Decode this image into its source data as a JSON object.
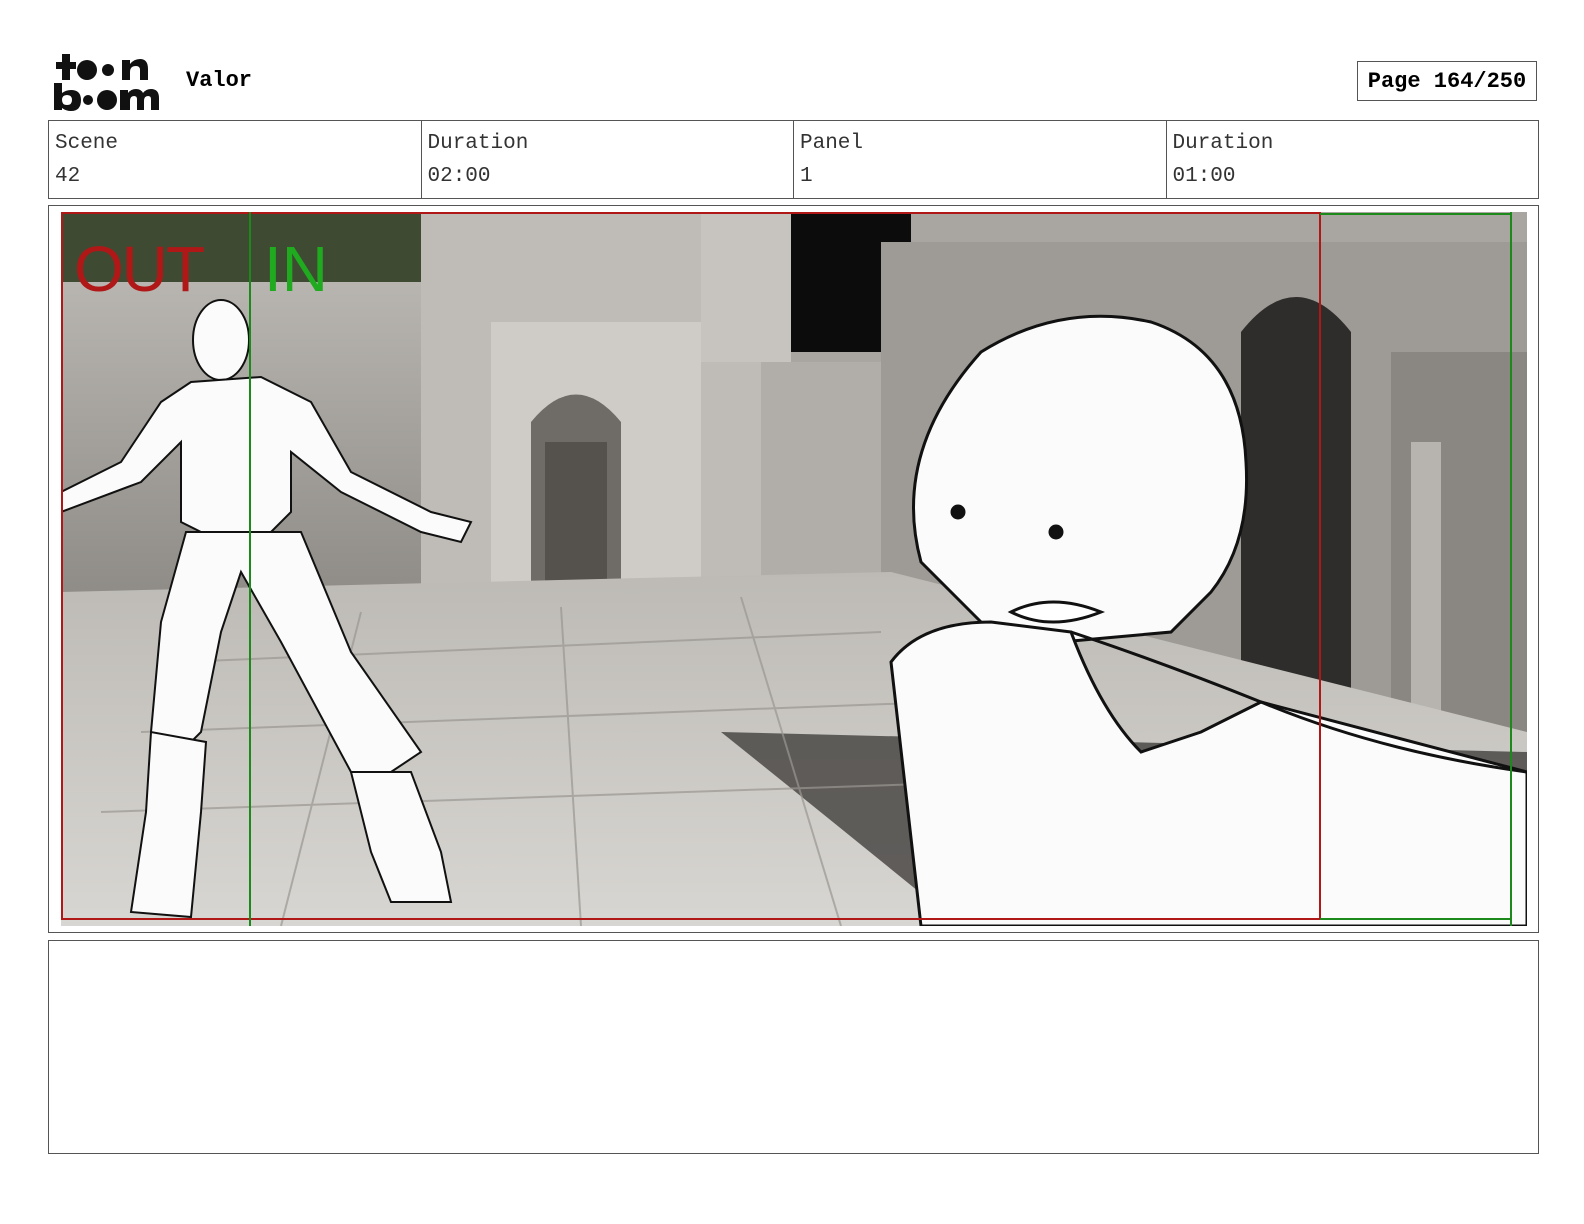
{
  "header": {
    "logo_text_top": "toon",
    "logo_text_bottom": "boom",
    "project": "Valor",
    "page": "Page 164/250"
  },
  "info": {
    "scene_label": "Scene",
    "scene_value": "42",
    "scene_duration_label": "Duration",
    "scene_duration_value": "02:00",
    "panel_label": "Panel",
    "panel_value": "1",
    "panel_duration_label": "Duration",
    "panel_duration_value": "01:00"
  },
  "panel": {
    "out_label": "OUT",
    "in_label": "IN",
    "out_color": "#b01818",
    "in_color": "#1faa1f"
  },
  "notes": {
    "text": ""
  }
}
